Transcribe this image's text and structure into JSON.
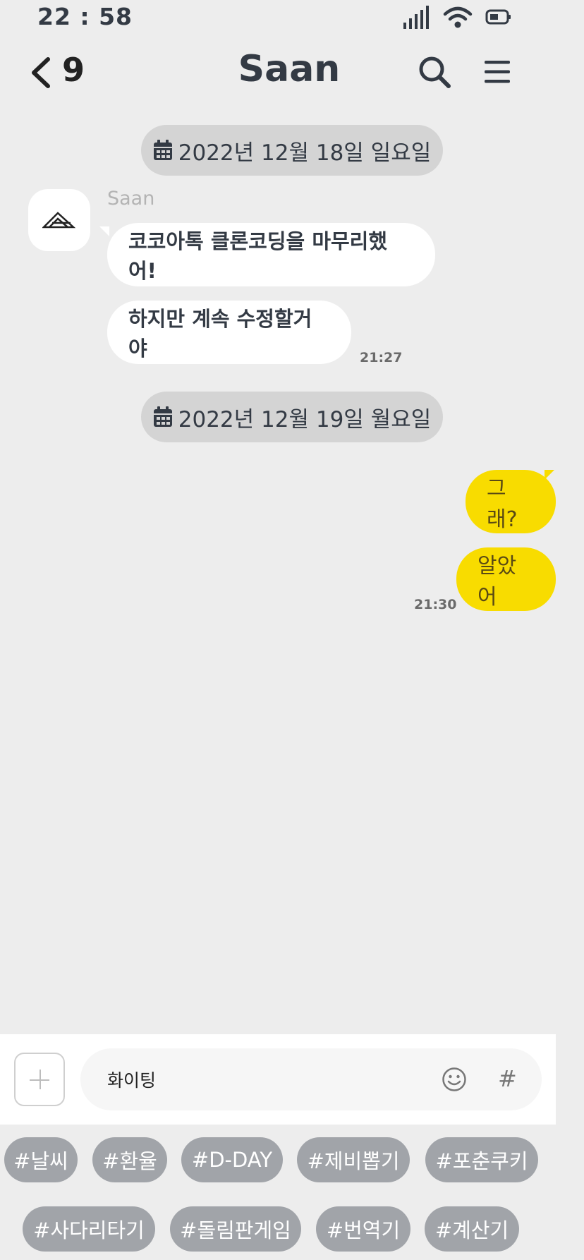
{
  "status_bar": {
    "time": "22 : 58"
  },
  "header": {
    "unread_count": "9",
    "title": "Saan"
  },
  "dates": [
    "2022년 12월 18일 일요일",
    "2022년 12월 19일 월요일"
  ],
  "conversation": {
    "sender_name": "Saan",
    "received": [
      {
        "text": "코코아톡 클론코딩을 마무리했어!"
      },
      {
        "text": "하지만 계속 수정할거야",
        "time": "21:27"
      }
    ],
    "sent": [
      {
        "text": "그래?"
      },
      {
        "text": "알았어",
        "time": "21:30"
      }
    ]
  },
  "composer": {
    "value": "화이팅",
    "hash_label": "#"
  },
  "tags": [
    "#날씨",
    "#환율",
    "#D-DAY",
    "#제비뽑기",
    "#포춘쿠키",
    "#사다리타기",
    "#돌림판게임",
    "#번역기",
    "#계산기"
  ],
  "colors": {
    "background": "#ededed",
    "my_bubble": "#f8dc00",
    "tag": "#a1a4a9"
  }
}
